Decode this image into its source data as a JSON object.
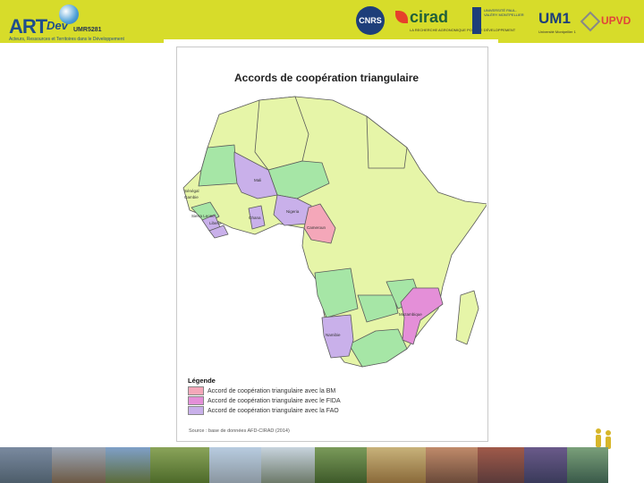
{
  "header": {
    "logo_main": "ART",
    "logo_dev": "Dev",
    "logo_umr": "UMR5281",
    "logo_tagline": "Acteurs, Ressources et Territoires dans le Développement",
    "partners": {
      "cnrs": "CNRS",
      "cirad": "cirad",
      "cirad_sub": "LA RECHERCHE AGRONOMIQUE POUR LE DÉVELOPPEMENT",
      "upv": "UNIVERSITÉ PAUL-VALÉRY MONTPELLIER",
      "um1": "UM1",
      "um1_sub": "Université Montpellier 1",
      "upvd": "UPVD"
    }
  },
  "map": {
    "title": "Accords de coopération triangulaire",
    "country_labels": {
      "mali": "Mali",
      "senegal": "Sénégal",
      "gambia": "Gambie",
      "sierra_leone": "Sierra Leone",
      "liberia": "Liberia",
      "ghana": "Ghana",
      "nigeria": "Nigeria",
      "cameroon": "Cameroun",
      "mozambique": "Mozambique",
      "namibia": "Namibie"
    },
    "legend": {
      "title": "Légende",
      "items": [
        {
          "label": "Accord de coopération triangulaire avec la BM",
          "color": "#f4a7b9"
        },
        {
          "label": "Accord de coopération triangulaire avec le FIDA",
          "color": "#e48fd8"
        },
        {
          "label": "Accord de coopération triangulaire avec la FAO",
          "color": "#c9b0ea"
        }
      ]
    },
    "source": "Source : base de données AFD-CIRAD (2014)"
  },
  "colors": {
    "header_bg": "#d7dc2a",
    "base_country": "#e6f5a8",
    "other_group": "#a6e6a6",
    "fao": "#c9b0ea",
    "bm": "#f4a7b9",
    "fida": "#e48fd8"
  }
}
